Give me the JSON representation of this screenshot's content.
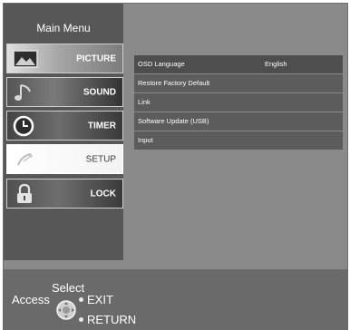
{
  "sidebar": {
    "title": "Main Menu",
    "items": [
      {
        "label": "PICTURE",
        "icon": "picture-icon"
      },
      {
        "label": "SOUND",
        "icon": "music-note-icon"
      },
      {
        "label": "TIMER",
        "icon": "clock-icon"
      },
      {
        "label": "SETUP",
        "icon": "satellite-dish-icon",
        "selected": true
      },
      {
        "label": "LOCK",
        "icon": "padlock-icon"
      }
    ]
  },
  "setup": {
    "rows": [
      {
        "label": "OSD Language",
        "value": "English"
      },
      {
        "label": "Restore Factory Default",
        "value": ""
      },
      {
        "label": "Link",
        "value": ""
      },
      {
        "label": "Software Update (USB)",
        "value": ""
      },
      {
        "label": "Input",
        "value": ""
      }
    ]
  },
  "footer": {
    "select": "Select",
    "access": "Access",
    "exit": "EXIT",
    "return": "RETURN"
  },
  "colors": {
    "panel": "#8a8a8a",
    "sidebar": "#575757",
    "row": "#5c5c5c",
    "footer": "#6a6a6a",
    "text": "#ffffff"
  }
}
